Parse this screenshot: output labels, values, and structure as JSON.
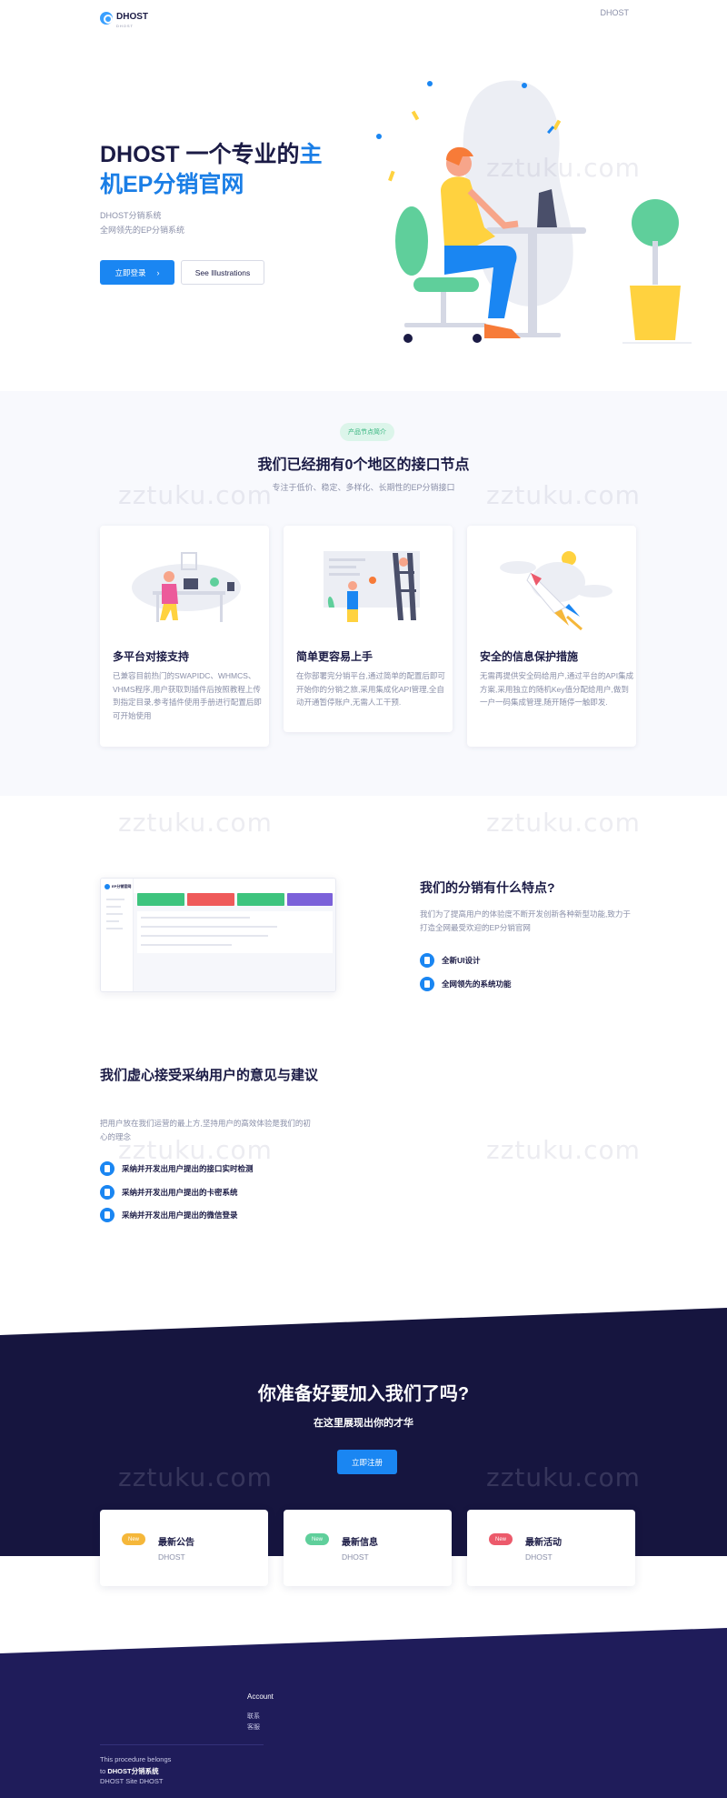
{
  "header": {
    "logo_text": "DHOST",
    "logo_sub": "DHOST",
    "nav_brand": "DHOST"
  },
  "hero": {
    "title_line1_dark": "DHOST 一个专业的",
    "title_line1_blue": "主",
    "title_line2_blue": "机EP分销官网",
    "sub1": "DHOST分销系统",
    "sub2": "全网领先的EP分销系统",
    "login_button": "立即登录",
    "illustrations_button": "See Illustrations"
  },
  "nodes": {
    "pill": "产品节点简介",
    "title": "我们已经拥有0个地区的接口节点",
    "subtitle": "专注于低价、稳定、多样化、长期性的EP分销接口",
    "cards": [
      {
        "title": "多平台对接支持",
        "desc": "已兼容目前热门的SWAPIDC、WHMCS、VHMS程序,用户获取到插件后按照教程上传到指定目录,参考插件使用手册进行配置后即可开始使用"
      },
      {
        "title": "简单更容易上手",
        "desc": "在你部署完分销平台,通过简单的配置后即可开始你的分销之旅,采用集成化API管理,全自动开通暂停账户,无需人工干预."
      },
      {
        "title": "安全的信息保护措施",
        "desc": "无需再提供安全码给用户,通过平台的API集成方案,采用独立的随机Key值分配给用户,做到一户一码集成管理,随开随停一触即发."
      }
    ]
  },
  "features": {
    "title": "我们的分销有什么特点?",
    "desc": "我们为了提高用户的体验度不断开发创新各种新型功能,致力于打造全网最受欢迎的EP分销官网",
    "items": [
      "全新UI设计",
      "全网领先的系统功能"
    ]
  },
  "feedback": {
    "title": "我们虚心接受采纳用户的意见与建议",
    "desc": "把用户放在我们运营的最上方,坚持用户的高效体验是我们的初心的理念",
    "items": [
      "采纳并开发出用户提出的接口实时检测",
      "采纳并开发出用户提出的卡密系统",
      "采纳并开发出用户提出的微信登录"
    ]
  },
  "cta": {
    "title": "你准备好要加入我们了吗?",
    "subtitle": "在这里展现出你的才华",
    "button": "立即注册"
  },
  "news": [
    {
      "badge": "New",
      "title": "最新公告",
      "sub": "DHOST",
      "color": "#f5b73a"
    },
    {
      "badge": "New",
      "title": "最新信息",
      "sub": "DHOST",
      "color": "#5fcf9b"
    },
    {
      "badge": "New",
      "title": "最新活动",
      "sub": "DHOST",
      "color": "#ec5a6b"
    }
  ],
  "footer": {
    "account_heading": "Account",
    "links": [
      "联系",
      "客服"
    ],
    "note_line1": "This procedure belongs",
    "note_line2_prefix": "to ",
    "note_line2_bold": "DHOST分销系统",
    "note_line3": "DHOST Site DHOST"
  },
  "mock": {
    "brand": "EP分销官网",
    "stat_colors": [
      "#3ec47e",
      "#ef5a5a",
      "#3ec47e",
      "#7b61d9"
    ]
  },
  "watermark": "zztuku.com",
  "colors": {
    "primary": "#1a86f2",
    "dark_navy": "#16153f",
    "footer_navy": "#1f1c5a"
  }
}
